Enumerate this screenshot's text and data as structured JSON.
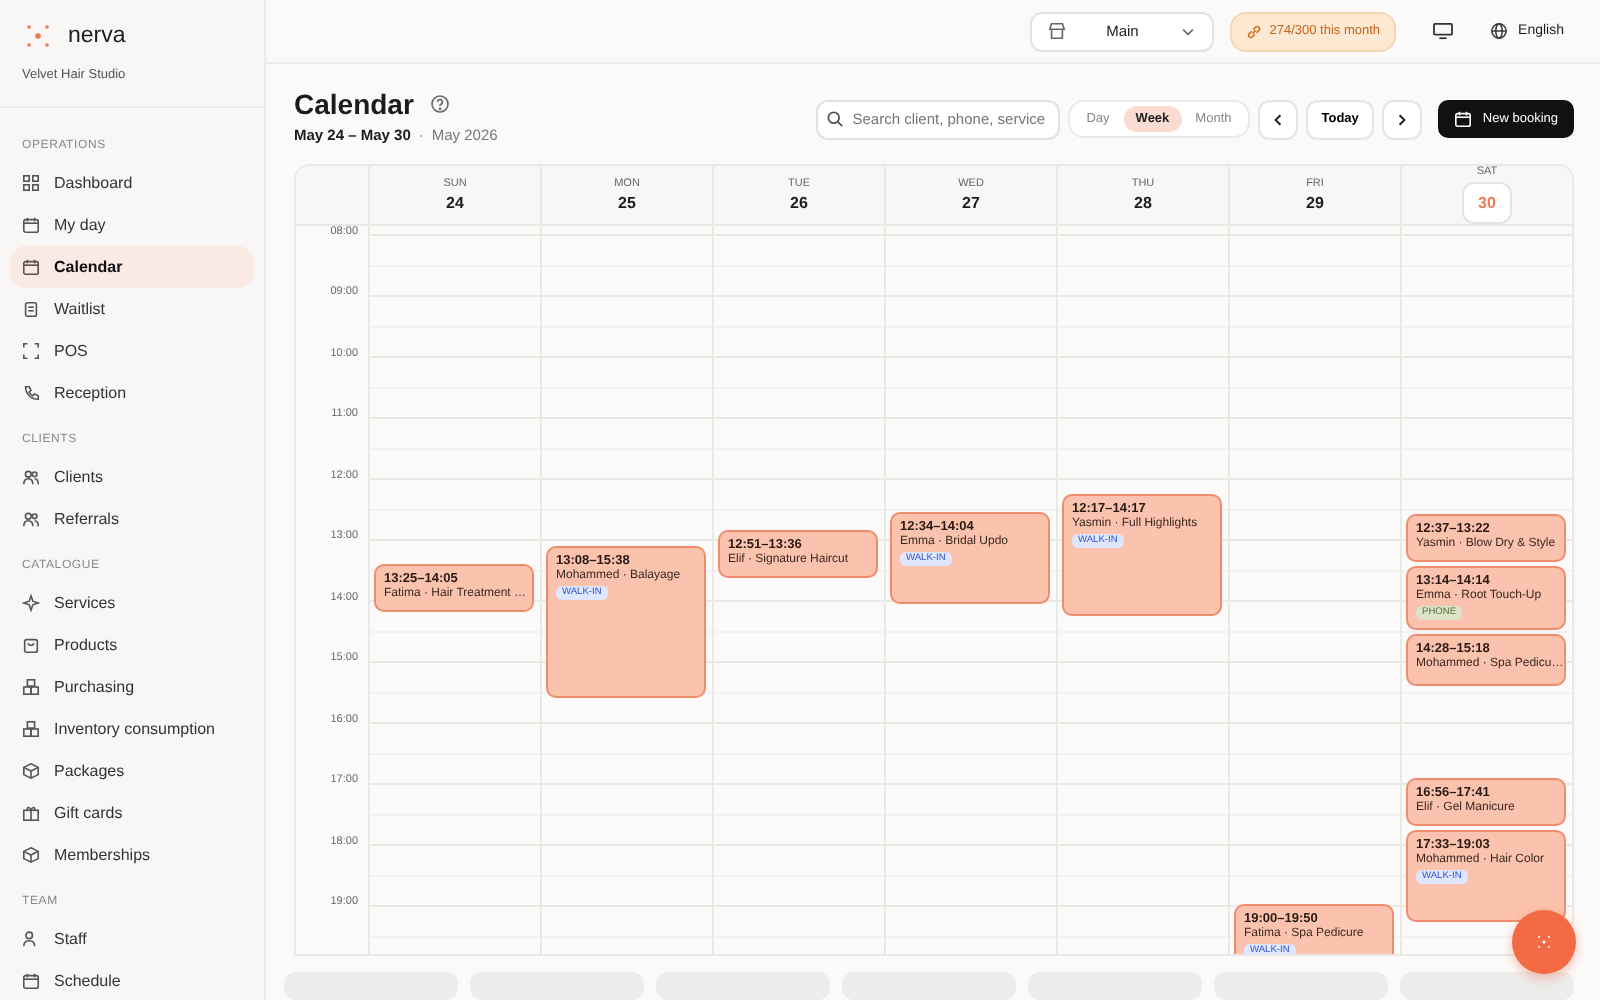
{
  "brand": {
    "name": "nerva",
    "workspace": "Velvet Hair Studio"
  },
  "sidebar": {
    "sections": [
      {
        "label": "OPERATIONS",
        "items": [
          {
            "label": "Dashboard",
            "selected": false
          },
          {
            "label": "My day",
            "selected": false
          },
          {
            "label": "Calendar",
            "selected": true
          },
          {
            "label": "Waitlist",
            "selected": false
          },
          {
            "label": "POS",
            "selected": false
          },
          {
            "label": "Reception",
            "selected": false
          }
        ]
      },
      {
        "label": "CLIENTS",
        "items": [
          {
            "label": "Clients",
            "selected": false
          },
          {
            "label": "Referrals",
            "selected": false
          }
        ]
      },
      {
        "label": "CATALOGUE",
        "items": [
          {
            "label": "Services",
            "selected": false
          },
          {
            "label": "Products",
            "selected": false
          },
          {
            "label": "Purchasing",
            "selected": false
          },
          {
            "label": "Inventory consumption",
            "selected": false
          },
          {
            "label": "Packages",
            "selected": false
          },
          {
            "label": "Gift cards",
            "selected": false
          },
          {
            "label": "Memberships",
            "selected": false
          }
        ]
      },
      {
        "label": "TEAM",
        "items": [
          {
            "label": "Staff",
            "selected": false
          },
          {
            "label": "Schedule",
            "selected": false
          }
        ]
      }
    ]
  },
  "topbar": {
    "location": "Main",
    "usage": "274/300 this month",
    "language": "English"
  },
  "header": {
    "title": "Calendar",
    "range": "May 24 – May 30",
    "separator": "·",
    "month": "May 2026",
    "search": {
      "placeholder": "Search client, phone, service"
    },
    "views": [
      {
        "label": "Day",
        "selected": false
      },
      {
        "label": "Week",
        "selected": true
      },
      {
        "label": "Month",
        "selected": false
      }
    ],
    "today_button": "Today",
    "new_booking": "New booking"
  },
  "calendar": {
    "hours": [
      "08:00",
      "09:00",
      "10:00",
      "11:00",
      "12:00",
      "13:00",
      "14:00",
      "15:00",
      "16:00",
      "17:00",
      "18:00",
      "19:00"
    ],
    "days": [
      {
        "weekday": "SUN",
        "date": "24",
        "today": false,
        "events": [
          {
            "time": "13:25–14:05",
            "title": "Fatima · Hair Treatment …"
          }
        ]
      },
      {
        "weekday": "MON",
        "date": "25",
        "today": false,
        "events": [
          {
            "time": "13:08–15:38",
            "title": "Mohammed · Balayage",
            "tag": {
              "label": "WALK-IN",
              "kind": "walk-in"
            }
          }
        ]
      },
      {
        "weekday": "TUE",
        "date": "26",
        "today": false,
        "events": [
          {
            "time": "12:51–13:36",
            "title": "Elif · Signature Haircut"
          }
        ]
      },
      {
        "weekday": "WED",
        "date": "27",
        "today": false,
        "events": [
          {
            "time": "12:34–14:04",
            "title": "Emma · Bridal Updo",
            "tag": {
              "label": "WALK-IN",
              "kind": "walk-in"
            }
          }
        ]
      },
      {
        "weekday": "THU",
        "date": "28",
        "today": false,
        "events": [
          {
            "time": "12:17–14:17",
            "title": "Yasmin · Full Highlights",
            "tag": {
              "label": "WALK-IN",
              "kind": "walk-in"
            }
          }
        ]
      },
      {
        "weekday": "FRI",
        "date": "29",
        "today": false,
        "events": [
          {
            "time": "19:00–19:50",
            "title": "Fatima · Spa Pedicure",
            "tag": {
              "label": "WALK-IN",
              "kind": "walk-in"
            }
          }
        ]
      },
      {
        "weekday": "SAT",
        "date": "30",
        "today": true,
        "events": [
          {
            "time": "12:37–13:22",
            "title": "Yasmin · Blow Dry & Style"
          },
          {
            "time": "13:14–14:14",
            "title": "Emma · Root Touch-Up",
            "tag": {
              "label": "PHONE",
              "kind": "phone"
            }
          },
          {
            "time": "14:28–15:18",
            "title": "Mohammed · Spa Pedicu…"
          },
          {
            "time": "16:56–17:41",
            "title": "Elif · Gel Manicure"
          },
          {
            "time": "17:33–19:03",
            "title": "Mohammed · Hair Color",
            "tag": {
              "label": "WALK-IN",
              "kind": "walk-in"
            }
          }
        ]
      }
    ]
  }
}
